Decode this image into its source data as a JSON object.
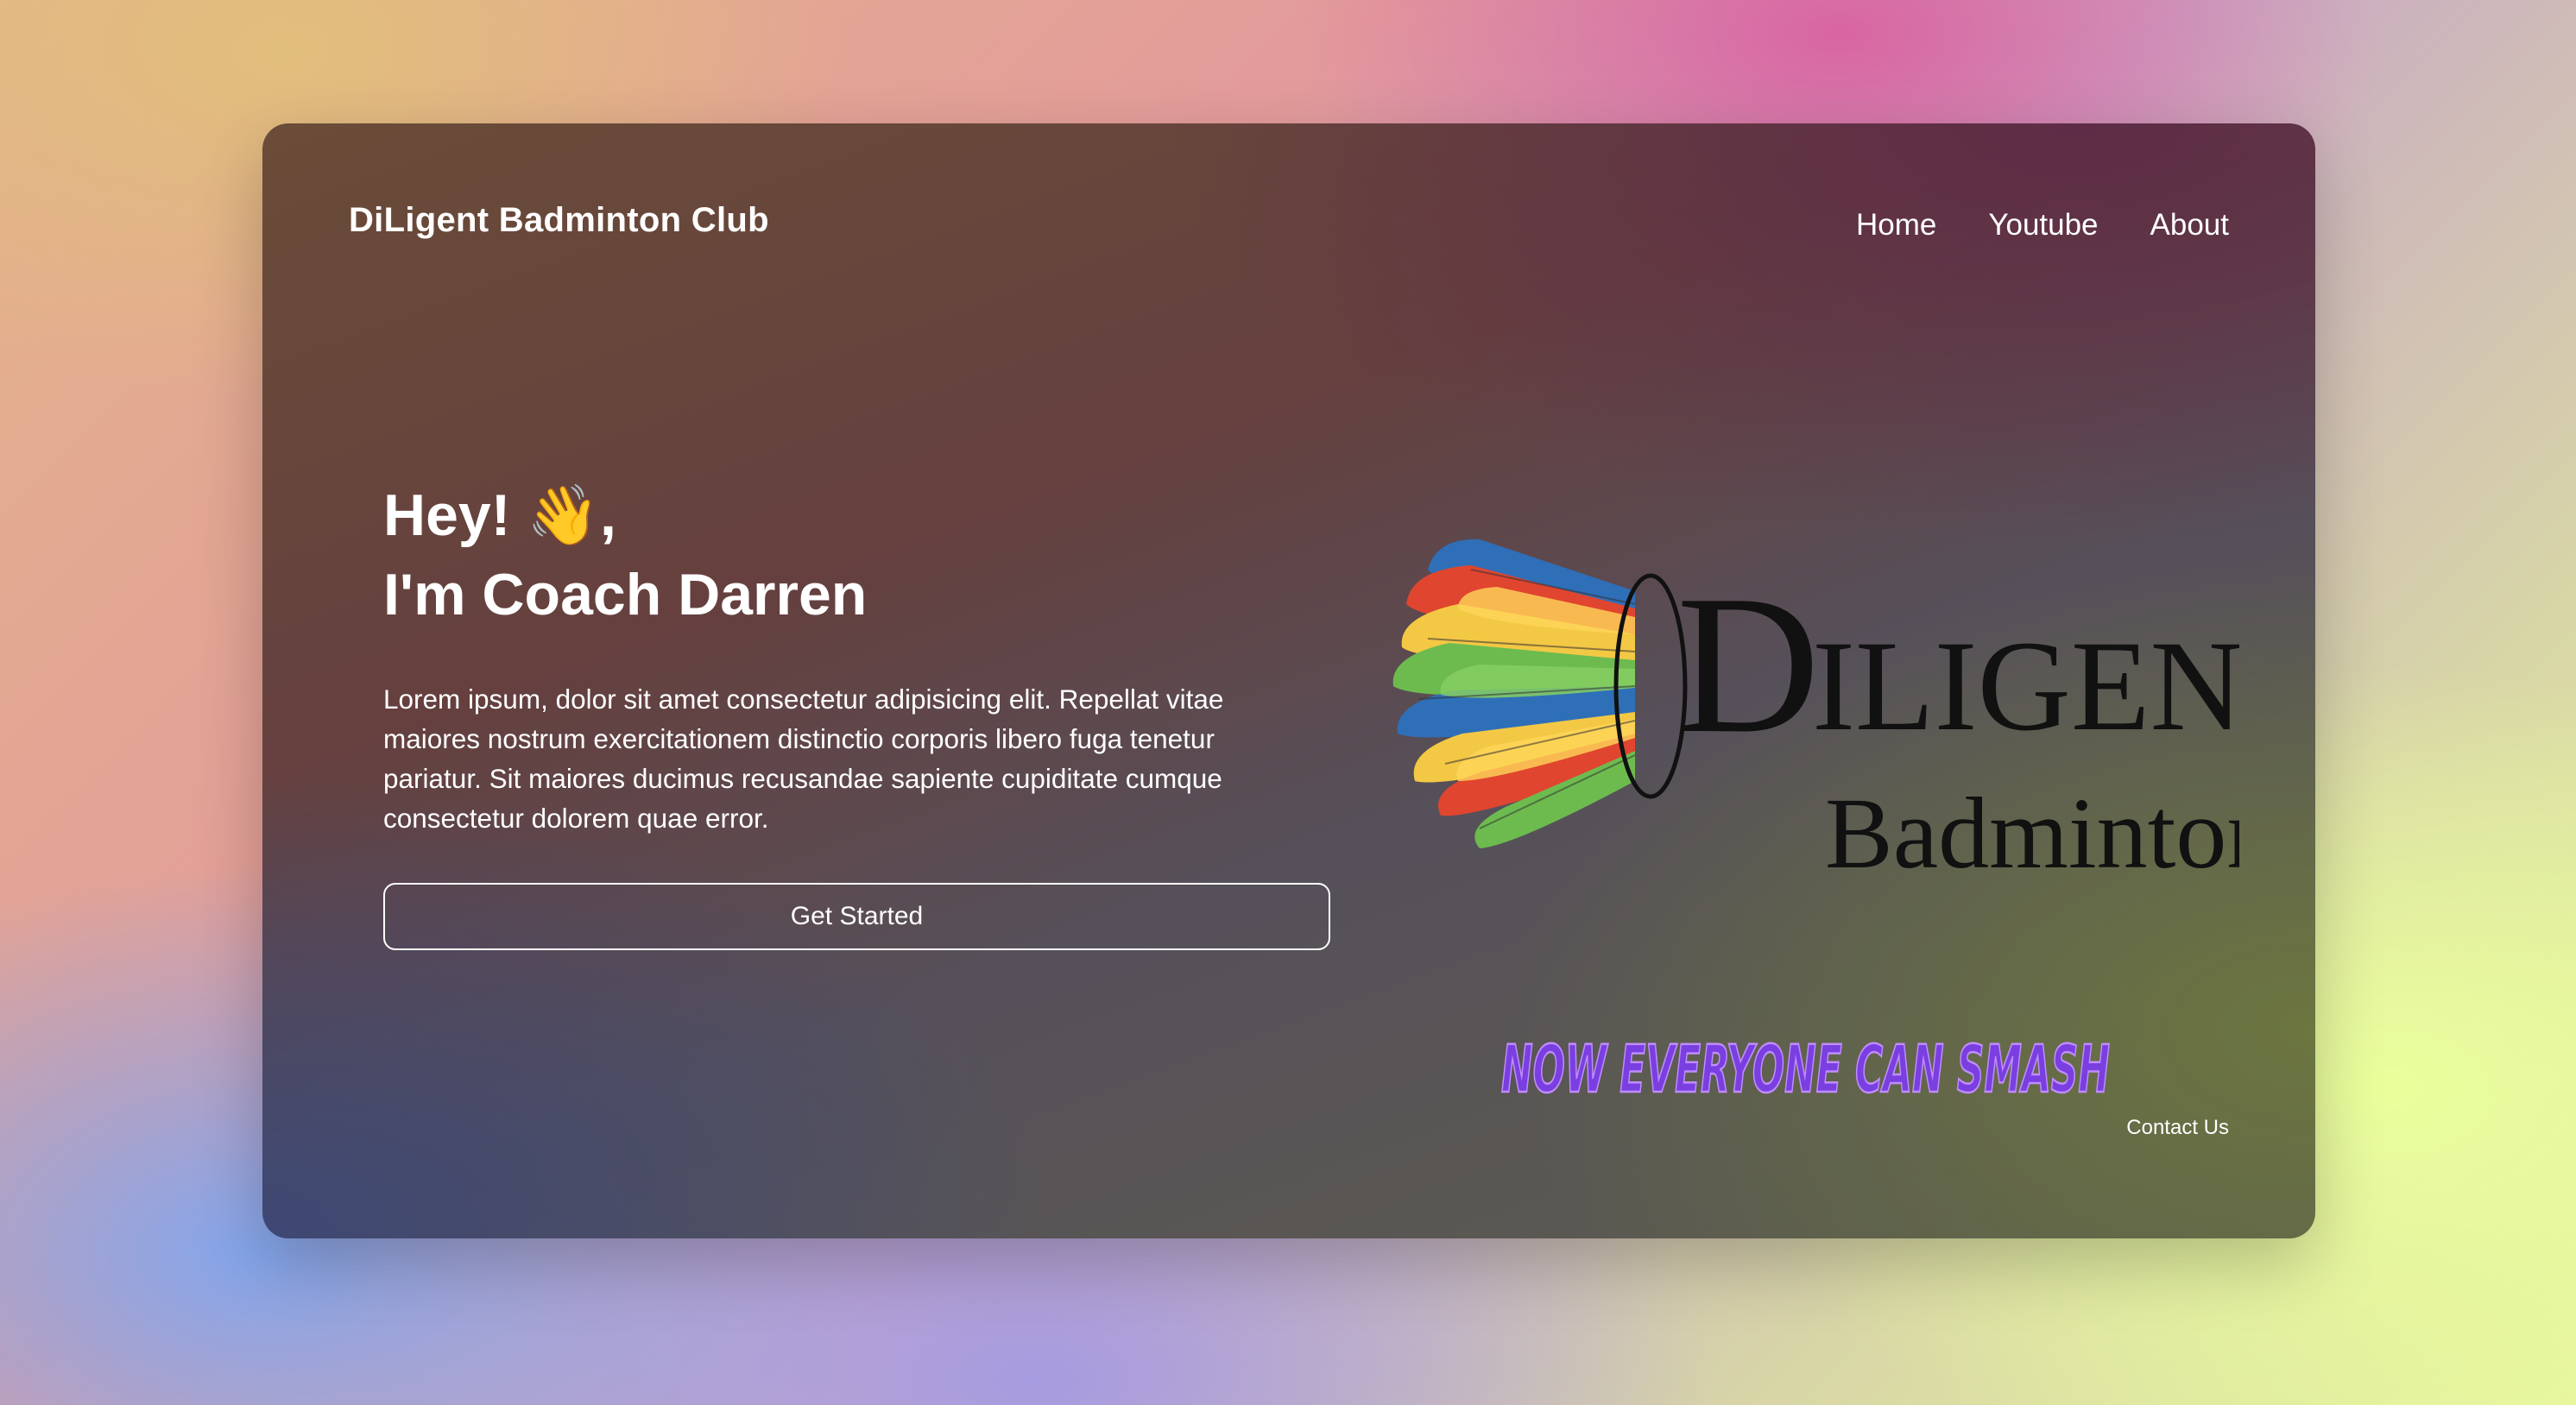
{
  "header": {
    "brand": "DiLigent Badminton Club",
    "nav": [
      "Home",
      "Youtube",
      "About"
    ]
  },
  "hero": {
    "title_line1": "Hey! 👋,",
    "title_line2": "I'm Coach Darren",
    "paragraph": "Lorem ipsum, dolor sit amet consectetur adipisicing elit. Repellat vitae maiores nostrum exercitationem distinctio corporis libero fuga tenetur pariatur. Sit maiores ducimus recusandae sapiente cupiditate cumque consectetur dolorem quae error.",
    "cta_label": "Get Started"
  },
  "logo": {
    "first_letter": "D",
    "word_rest": "ILIGENT",
    "subtitle": "Badminton Club"
  },
  "tagline": "NOW EVERYONE CAN SMASH",
  "footer": {
    "contact_label": "Contact Us"
  },
  "colors": {
    "text": "#ffffff",
    "logo_text": "#111111",
    "tagline_fill": "#7a3fe0",
    "tagline_stroke": "#c18cff",
    "feather_red": "#e0452f",
    "feather_yellow": "#f3c844",
    "feather_green": "#6dbb4f",
    "feather_blue": "#2f6fb8"
  }
}
